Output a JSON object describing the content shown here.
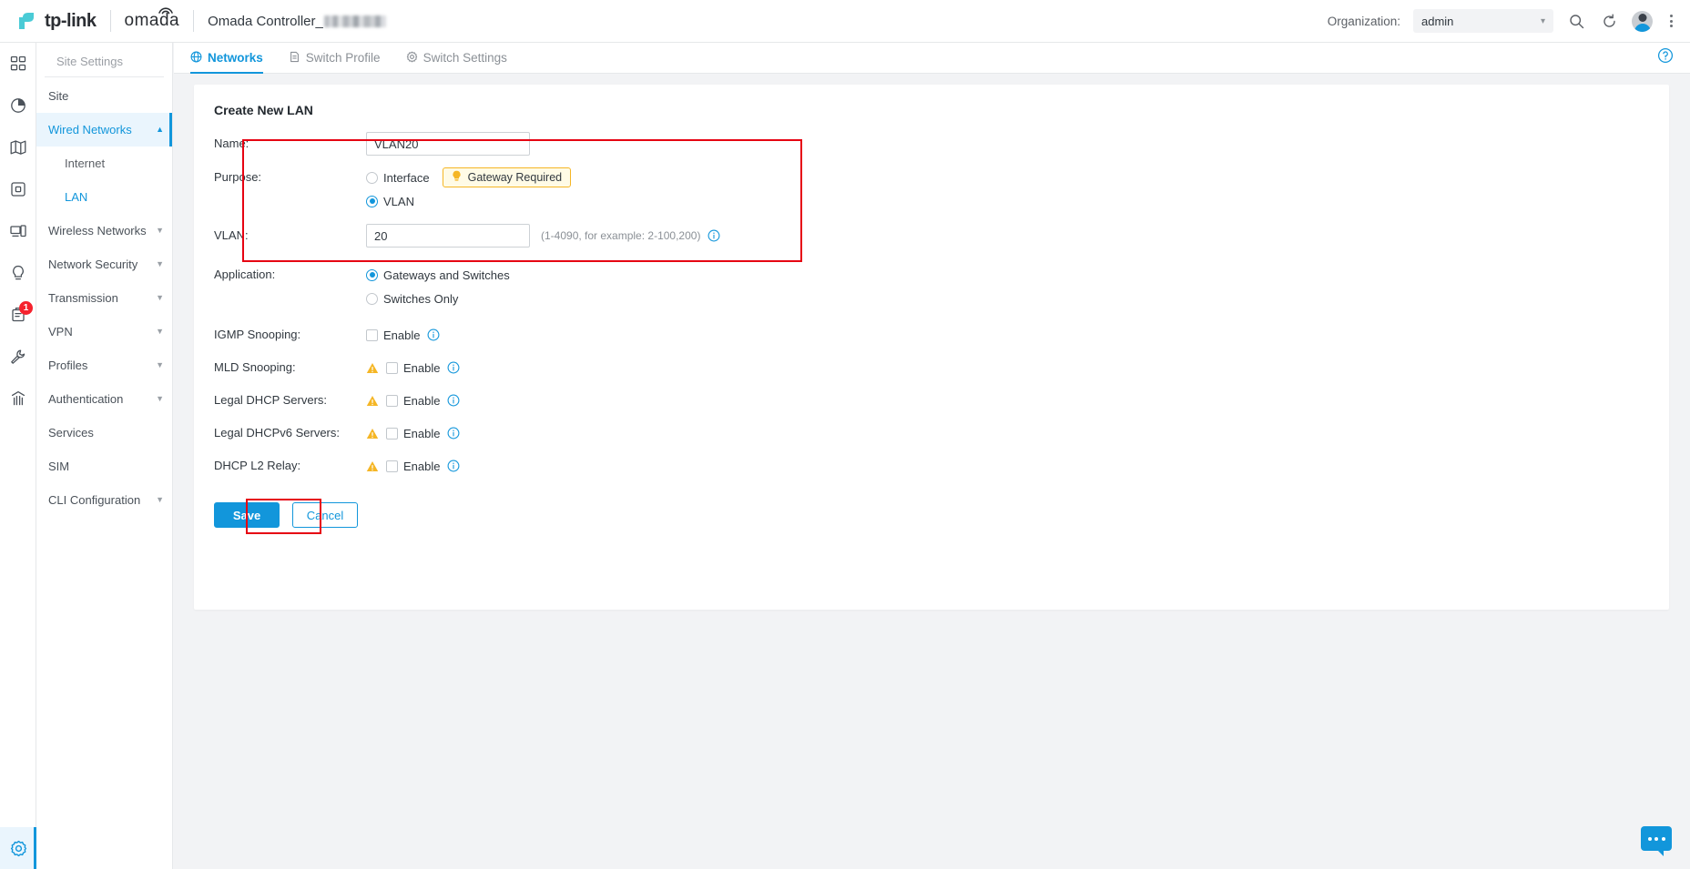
{
  "topbar": {
    "brand_tplink": "tp-link",
    "brand_omada": "omada",
    "controller_name": "Omada Controller_",
    "organization_label": "Organization:",
    "organization_value": "admin",
    "icons": [
      "search-icon",
      "refresh-icon",
      "avatar",
      "more-menu-icon"
    ]
  },
  "rail": {
    "items": [
      {
        "name": "dashboard-icon",
        "badge": ""
      },
      {
        "name": "statistics-pie-icon",
        "badge": ""
      },
      {
        "name": "map-icon",
        "badge": ""
      },
      {
        "name": "devices-icon",
        "badge": ""
      },
      {
        "name": "clients-icon",
        "badge": ""
      },
      {
        "name": "insight-bulb-icon",
        "badge": ""
      },
      {
        "name": "log-icon",
        "badge": "1"
      },
      {
        "name": "tools-wrench-icon",
        "badge": ""
      },
      {
        "name": "report-chart-icon",
        "badge": ""
      }
    ],
    "bottom": {
      "name": "settings-gear-icon",
      "active": true
    }
  },
  "sidebar": {
    "title": "Site Settings",
    "items": [
      {
        "label": "Site",
        "type": "item"
      },
      {
        "label": "Wired Networks",
        "type": "parent",
        "active": true,
        "expanded": true
      },
      {
        "label": "Internet",
        "type": "sub",
        "active": false
      },
      {
        "label": "LAN",
        "type": "sub",
        "active": true
      },
      {
        "label": "Wireless Networks",
        "type": "parent",
        "active": false
      },
      {
        "label": "Network Security",
        "type": "parent",
        "active": false
      },
      {
        "label": "Transmission",
        "type": "parent",
        "active": false
      },
      {
        "label": "VPN",
        "type": "parent",
        "active": false
      },
      {
        "label": "Profiles",
        "type": "parent",
        "active": false
      },
      {
        "label": "Authentication",
        "type": "parent",
        "active": false
      },
      {
        "label": "Services",
        "type": "item"
      },
      {
        "label": "SIM",
        "type": "item"
      },
      {
        "label": "CLI Configuration",
        "type": "parent",
        "active": false
      }
    ]
  },
  "tabs": [
    {
      "label": "Networks",
      "icon": "globe-icon",
      "active": true
    },
    {
      "label": "Switch Profile",
      "icon": "document-icon",
      "active": false
    },
    {
      "label": "Switch Settings",
      "icon": "gear-icon",
      "active": false
    }
  ],
  "form": {
    "title": "Create New LAN",
    "name": {
      "label": "Name:",
      "value": "VLAN20"
    },
    "purpose": {
      "label": "Purpose:",
      "options": [
        {
          "label": "Interface",
          "checked": false
        },
        {
          "label": "VLAN",
          "checked": true
        }
      ],
      "badge": "Gateway Required"
    },
    "vlan": {
      "label": "VLAN:",
      "value": "20",
      "hint": "(1-4090, for example: 2-100,200)"
    },
    "application": {
      "label": "Application:",
      "options": [
        {
          "label": "Gateways and Switches",
          "checked": true
        },
        {
          "label": "Switches Only",
          "checked": false
        }
      ]
    },
    "toggles": [
      {
        "label": "IGMP Snooping:",
        "enable_label": "Enable",
        "checked": false,
        "warning": false
      },
      {
        "label": "MLD Snooping:",
        "enable_label": "Enable",
        "checked": false,
        "warning": true
      },
      {
        "label": "Legal DHCP Servers:",
        "enable_label": "Enable",
        "checked": false,
        "warning": true
      },
      {
        "label": "Legal DHCPv6 Servers:",
        "enable_label": "Enable",
        "checked": false,
        "warning": true
      },
      {
        "label": "DHCP L2 Relay:",
        "enable_label": "Enable",
        "checked": false,
        "warning": true
      }
    ],
    "save_label": "Save",
    "cancel_label": "Cancel"
  },
  "colors": {
    "accent": "#1296db",
    "warning": "#f5b625",
    "annotation": "#e60012",
    "badge_red": "#f5222d"
  }
}
